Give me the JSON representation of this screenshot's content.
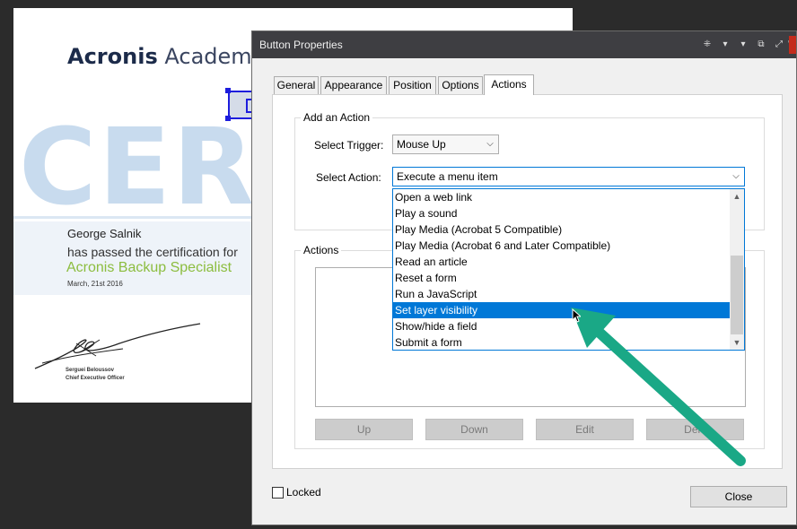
{
  "certificate": {
    "brand_bold": "Acronis",
    "brand_light": "Academy",
    "watermark": "CERT",
    "recipient": "George Salnik",
    "passed_text": "has passed the certification for",
    "course": "Acronis Backup Specialist",
    "date": "March, 21st 2016",
    "signer_name": "Serguei Beloussov",
    "signer_title": "Chief Executive Officer"
  },
  "dialog": {
    "title": "Button Properties",
    "titlebar_icons": [
      "pin-icon",
      "collapse-icon",
      "options-icon",
      "restore-icon",
      "maximize-icon",
      "minimize-icon",
      "close-icon"
    ],
    "tabs": [
      {
        "label": "General",
        "active": false
      },
      {
        "label": "Appearance",
        "active": false
      },
      {
        "label": "Position",
        "active": false
      },
      {
        "label": "Options",
        "active": false
      },
      {
        "label": "Actions",
        "active": true
      }
    ],
    "add_action": {
      "group_label": "Add an Action",
      "trigger_label": "Select Trigger:",
      "trigger_value": "Mouse Up",
      "action_label": "Select Action:",
      "action_value": "Execute a menu item"
    },
    "dropdown_options": [
      "Open a web link",
      "Play a sound",
      "Play Media (Acrobat 5 Compatible)",
      "Play Media (Acrobat 6 and Later Compatible)",
      "Read an article",
      "Reset a form",
      "Run a JavaScript",
      "Set layer visibility",
      "Show/hide a field",
      "Submit a form"
    ],
    "dropdown_selected": "Set layer visibility",
    "actions": {
      "group_label": "Actions",
      "buttons": {
        "up": "Up",
        "down": "Down",
        "edit": "Edit",
        "delete": "Dele"
      }
    },
    "locked_label": "Locked",
    "locked_checked": false,
    "close_label": "Close"
  },
  "colors": {
    "accent": "#0078d7",
    "annotation_arrow": "#1aa886",
    "course_green": "#8cbd3f",
    "titlebar": "#3e3e42"
  }
}
